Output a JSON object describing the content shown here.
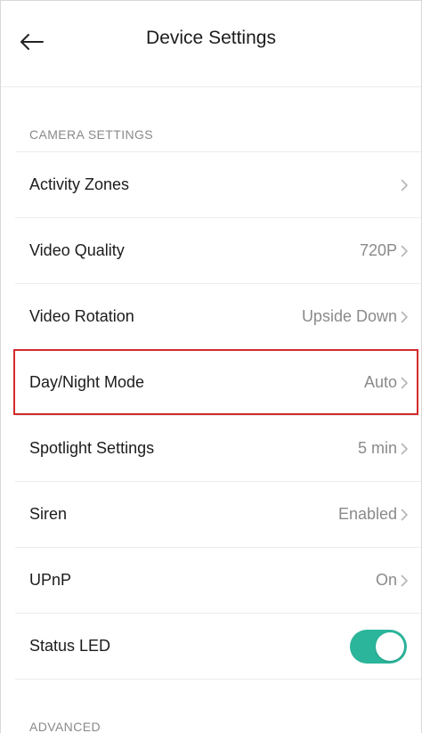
{
  "header": {
    "title": "Device Settings"
  },
  "sections": {
    "camera_settings": "CAMERA SETTINGS",
    "advanced": "ADVANCED"
  },
  "rows": [
    {
      "label": "Activity Zones",
      "value": ""
    },
    {
      "label": "Video Quality",
      "value": "720P"
    },
    {
      "label": "Video Rotation",
      "value": "Upside Down"
    },
    {
      "label": "Day/Night Mode",
      "value": "Auto"
    },
    {
      "label": "Spotlight Settings",
      "value": "5 min"
    },
    {
      "label": "Siren",
      "value": "Enabled"
    },
    {
      "label": "UPnP",
      "value": "On"
    }
  ],
  "status_led": {
    "label": "Status LED",
    "enabled": true
  },
  "colors": {
    "accent": "#2bb59b",
    "highlight_border": "#d32a2a",
    "secondary_text": "#8a8a8a"
  },
  "icons": {
    "back": "arrow-left-icon",
    "chevron": "chevron-right-icon"
  }
}
